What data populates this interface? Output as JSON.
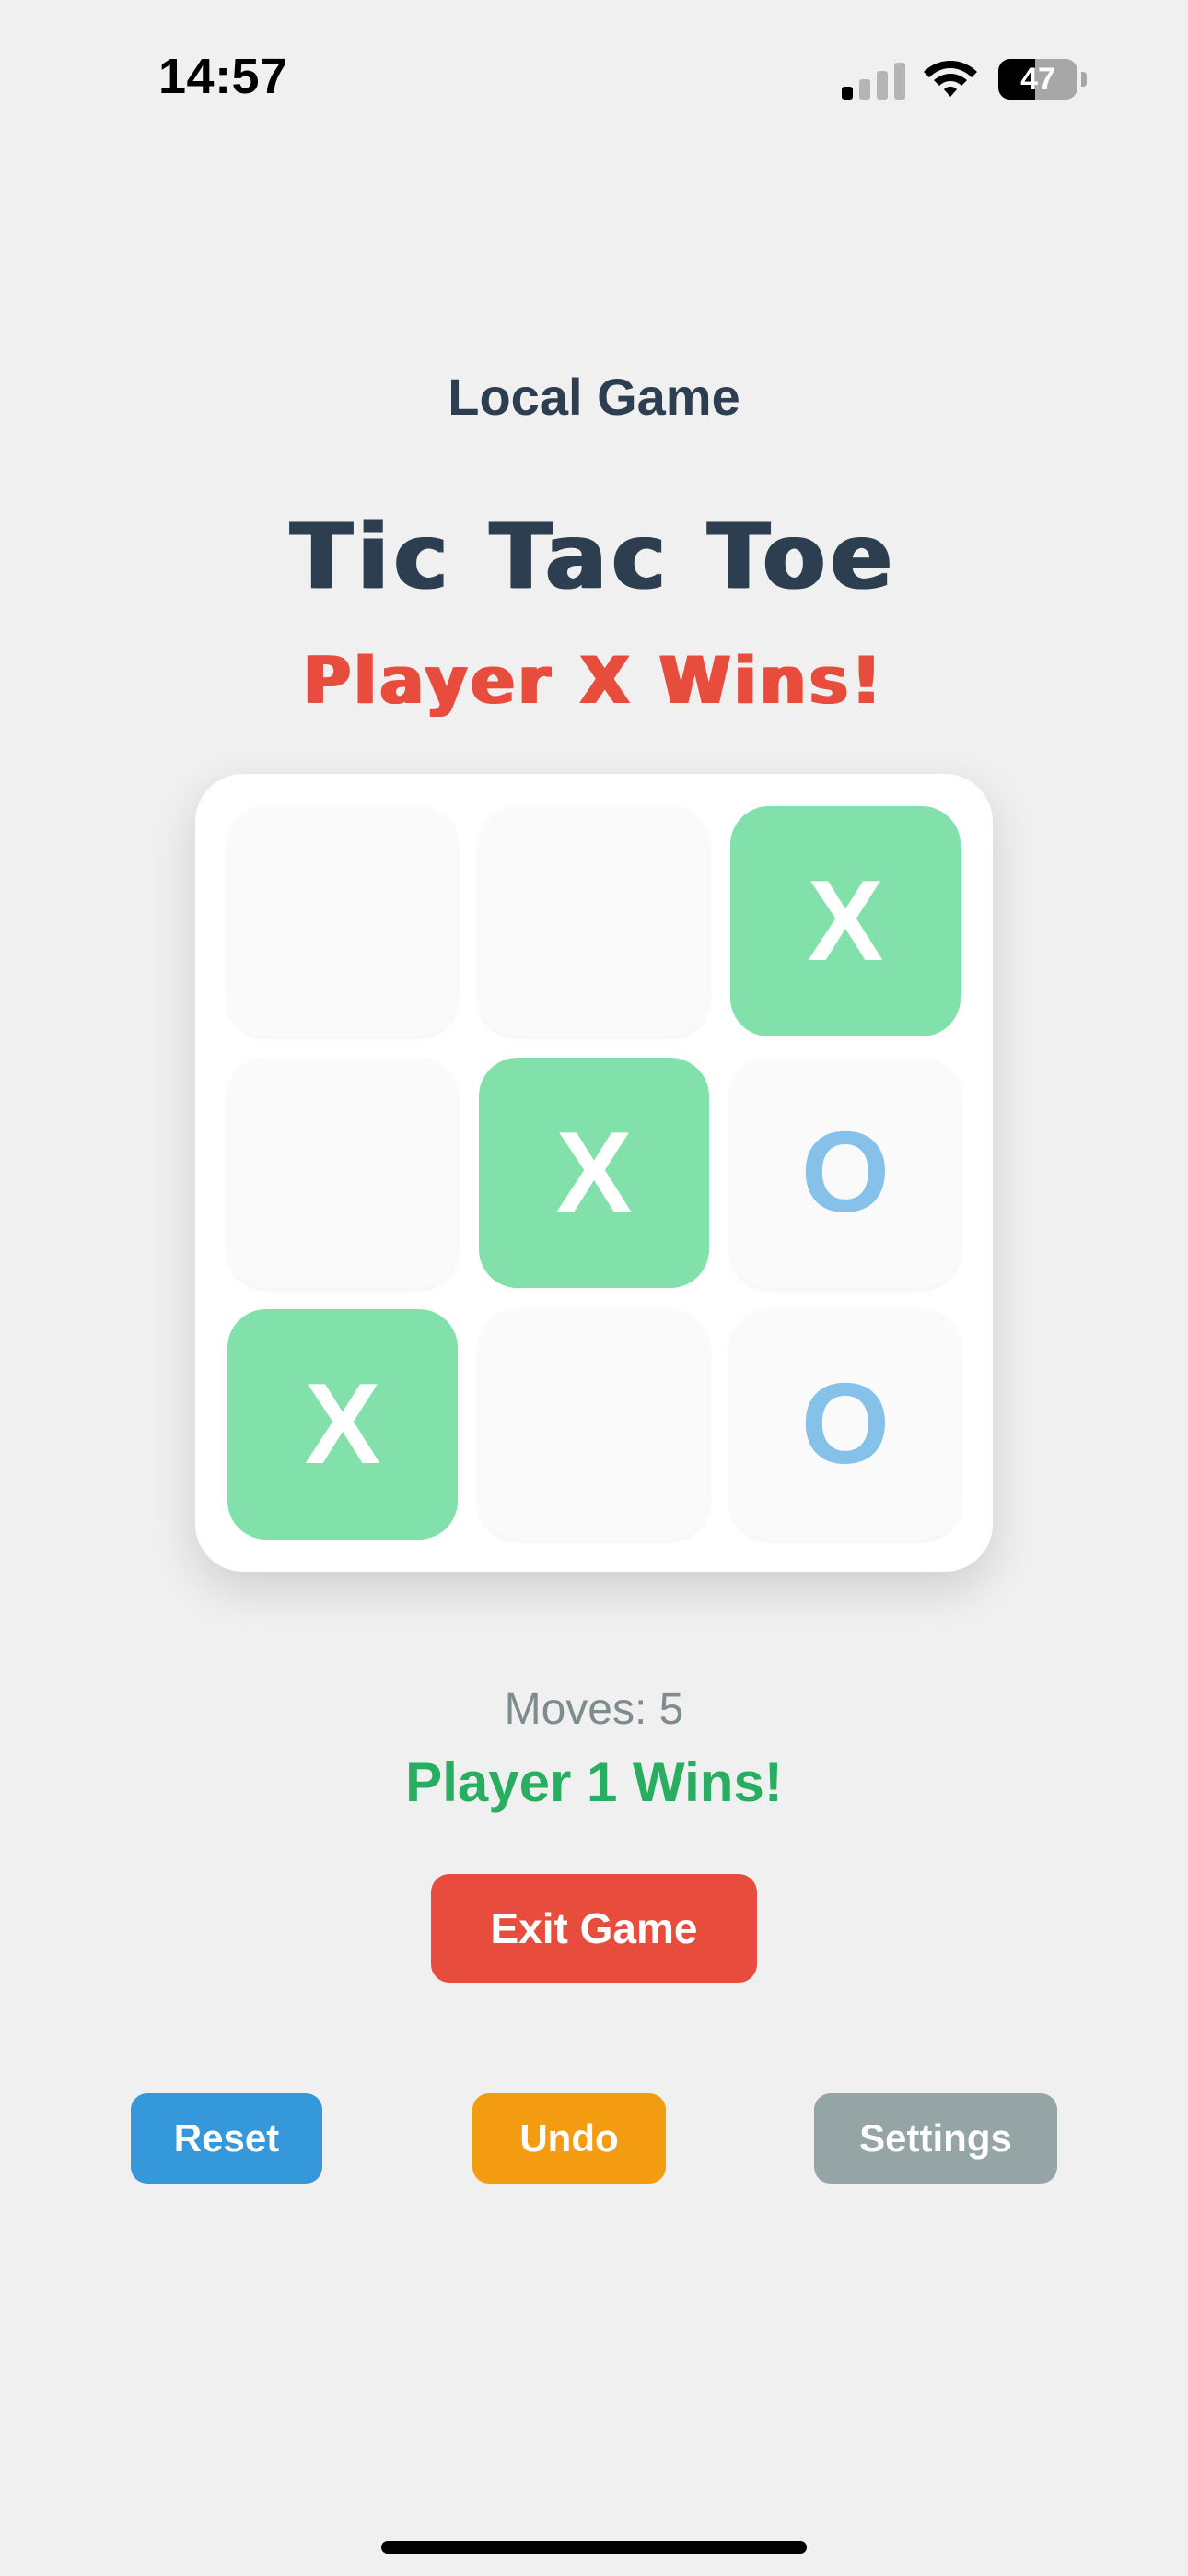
{
  "status_bar": {
    "time": "14:57",
    "battery_level": "47",
    "battery_fraction": 0.47,
    "signal_bars_active": 1,
    "signal_bars_total": 4
  },
  "header": {
    "mode_label": "Local Game",
    "title": "Tic Tac Toe",
    "result_banner": "Player X Wins!"
  },
  "board": {
    "cells": [
      {
        "mark": "",
        "winning": false
      },
      {
        "mark": "",
        "winning": false
      },
      {
        "mark": "X",
        "winning": true
      },
      {
        "mark": "",
        "winning": false
      },
      {
        "mark": "X",
        "winning": true
      },
      {
        "mark": "O",
        "winning": false
      },
      {
        "mark": "X",
        "winning": true
      },
      {
        "mark": "",
        "winning": false
      },
      {
        "mark": "O",
        "winning": false
      }
    ]
  },
  "game_status": {
    "moves": "Moves: 5",
    "winner": "Player 1 Wins!"
  },
  "actions": {
    "exit_label": "Exit Game",
    "reset_label": "Reset",
    "undo_label": "Undo",
    "settings_label": "Settings"
  },
  "colors": {
    "background": "#f0f0f0",
    "title": "#2c3e50",
    "banner": "#e74c3c",
    "winning_cell": "#82e0aa",
    "o_mark": "#85c1e9",
    "winner_text": "#27ae60",
    "exit_button": "#e74c3c",
    "reset_button": "#3498db",
    "undo_button": "#f39c12",
    "settings_button": "#95a5a6"
  },
  "icons": {
    "signal": "cellular-signal-icon",
    "wifi": "wifi-icon",
    "battery": "battery-icon"
  }
}
